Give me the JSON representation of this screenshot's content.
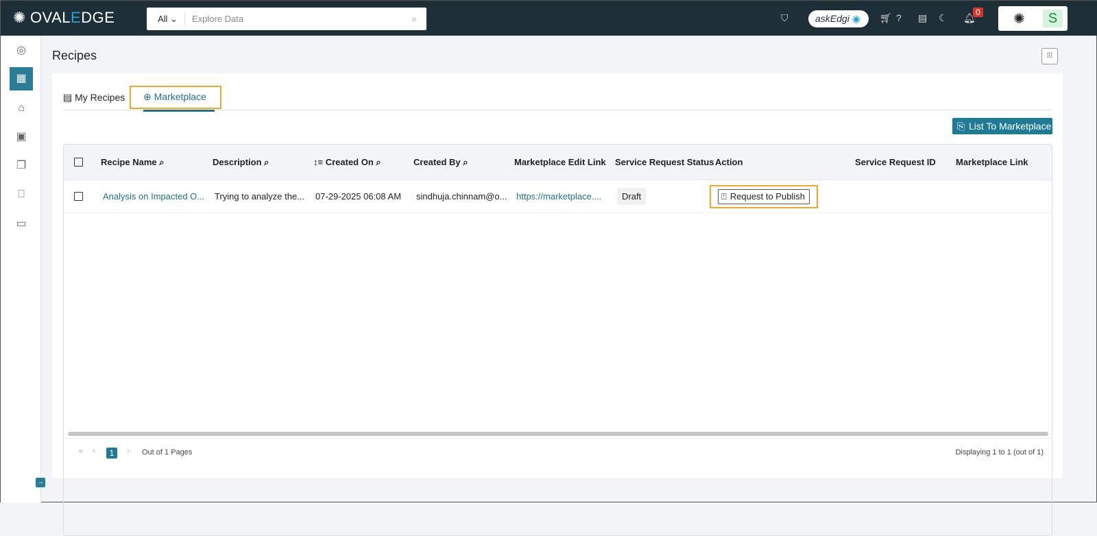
{
  "header": {
    "logo": "OVALEDGE",
    "search_scope": "All",
    "search_placeholder": "Explore Data",
    "askedgi": "askEdgi",
    "notification_count": "0",
    "user_initial": "S"
  },
  "sidebar": {
    "items": [
      "home-icon",
      "recipes-icon",
      "tag-icon",
      "report-icon",
      "files-icon",
      "book-icon",
      "chat-icon"
    ],
    "active": 1
  },
  "page": {
    "title": "Recipes",
    "tabs": [
      {
        "label": "My Recipes"
      },
      {
        "label": "Marketplace",
        "active": true
      }
    ],
    "list_button": "List To Marketplace"
  },
  "table": {
    "columns": [
      "Recipe Name",
      "Description",
      "Created On",
      "Created By",
      "Marketplace Edit Link",
      "Service Request Status",
      "Action",
      "Service Request ID",
      "Marketplace Link"
    ],
    "rows": [
      {
        "name": "Analysis on Impacted O...",
        "description": "Trying to analyze the...",
        "created_on": "07-29-2025 06:08 AM",
        "created_by": "sindhuja.chinnam@o...",
        "edit_link": "https://marketplace....",
        "status": "Draft",
        "action": "Request to Publish",
        "request_id": "",
        "marketplace_link": ""
      }
    ]
  },
  "pagination": {
    "page": "1",
    "out_of": "Out of 1 Pages",
    "displaying": "Displaying 1 to 1 (out of 1)"
  },
  "colors": {
    "accent": "#1f7a96",
    "header_bg": "#1f2f38",
    "highlight": "#f5a623"
  }
}
